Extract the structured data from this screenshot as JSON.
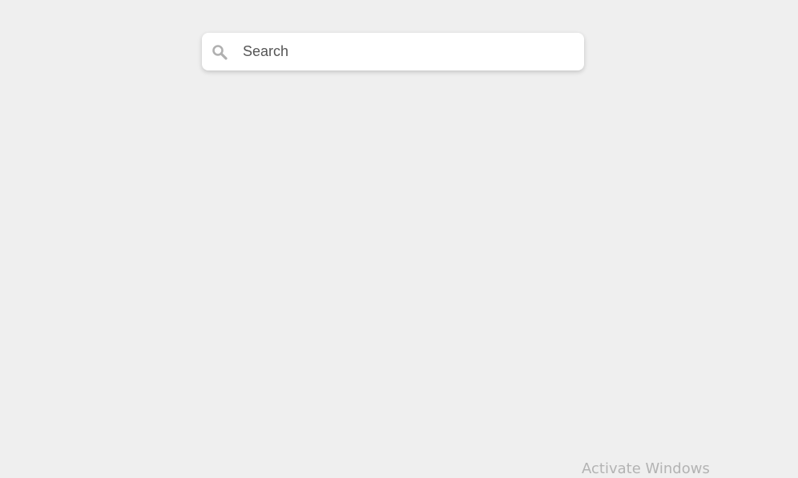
{
  "search": {
    "placeholder": "Search",
    "value": "",
    "icon": "search-icon"
  },
  "watermark": {
    "text": "Activate Windows"
  },
  "colors": {
    "background": "#efefef",
    "search_background": "#ffffff",
    "icon": "#b0b0b0",
    "watermark": "#b3b3b3"
  }
}
